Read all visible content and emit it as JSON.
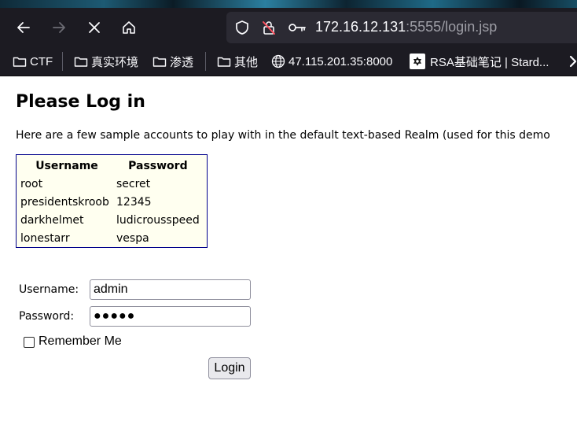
{
  "browser": {
    "url_host": "172.16.12.131",
    "url_rest": ":5555/login.jsp"
  },
  "bookmarks": [
    {
      "label": "CTF",
      "icon": "folder-icon"
    },
    {
      "label": "真实环境",
      "icon": "folder-icon"
    },
    {
      "label": "渗透",
      "icon": "folder-icon"
    },
    {
      "label": "其他",
      "icon": "folder-icon"
    },
    {
      "label": "47.115.201.35:8000",
      "icon": "globe-icon"
    },
    {
      "label": "RSA基础笔记 | Stard...",
      "icon": "star-of-david-icon"
    }
  ],
  "page": {
    "title": "Please Log in",
    "intro": "Here are a few sample accounts to play with in the default text-based Realm (used for this demo"
  },
  "accounts": {
    "headers": [
      "Username",
      "Password"
    ],
    "rows": [
      [
        "root",
        "secret"
      ],
      [
        "presidentskroob",
        "12345"
      ],
      [
        "darkhelmet",
        "ludicrousspeed"
      ],
      [
        "lonestarr",
        "vespa"
      ]
    ]
  },
  "form": {
    "username_label": "Username:",
    "username_value": "admin",
    "password_label": "Password:",
    "password_mask": "●●●●●",
    "remember_label": "Remember Me",
    "login_label": "Login"
  },
  "colors": {
    "toolbar": "#1c1b22",
    "urlbar": "#2b2a33",
    "table_border": "#00008b",
    "table_bg": "#fffff0"
  }
}
